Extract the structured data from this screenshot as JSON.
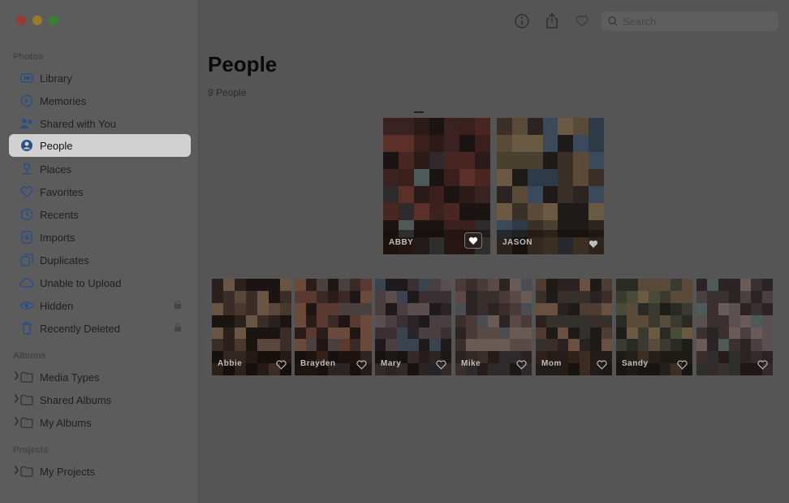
{
  "sidebar": {
    "sections": {
      "photos": "Photos",
      "albums": "Albums",
      "projects": "Projects"
    },
    "items": [
      {
        "label": "Library",
        "icon": "library-icon"
      },
      {
        "label": "Memories",
        "icon": "memories-icon"
      },
      {
        "label": "Shared with You",
        "icon": "shared-with-you-icon"
      },
      {
        "label": "People",
        "icon": "people-icon",
        "selected": true
      },
      {
        "label": "Places",
        "icon": "places-icon"
      },
      {
        "label": "Favorites",
        "icon": "heart-icon"
      },
      {
        "label": "Recents",
        "icon": "clock-icon"
      },
      {
        "label": "Imports",
        "icon": "imports-icon"
      },
      {
        "label": "Duplicates",
        "icon": "duplicates-icon"
      },
      {
        "label": "Unable to Upload",
        "icon": "cloud-icon"
      },
      {
        "label": "Hidden",
        "icon": "eye-icon",
        "locked": true
      },
      {
        "label": "Recently Deleted",
        "icon": "trash-icon",
        "locked": true
      }
    ],
    "album_groups": [
      {
        "label": "Media Types"
      },
      {
        "label": "Shared Albums"
      },
      {
        "label": "My Albums"
      }
    ],
    "project_groups": [
      {
        "label": "My Projects"
      }
    ]
  },
  "toolbar": {
    "search_placeholder": "Search"
  },
  "main": {
    "title": "People",
    "count": "9 People",
    "favorites": [
      {
        "name": "ABBY"
      },
      {
        "name": "JASON"
      }
    ],
    "people": [
      {
        "name": "Abbie"
      },
      {
        "name": "Brayden"
      },
      {
        "name": "Mary"
      },
      {
        "name": "Mike"
      },
      {
        "name": "Mom"
      },
      {
        "name": "Sandy"
      },
      {
        "name": ""
      }
    ]
  },
  "colors": {
    "accent": "#2a4f86",
    "selected_bg": "#d1d1d1"
  }
}
